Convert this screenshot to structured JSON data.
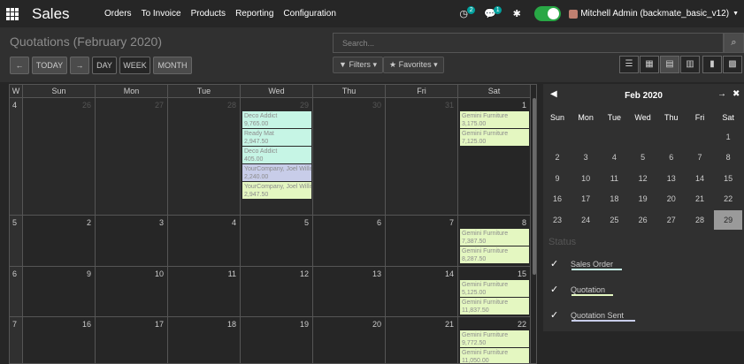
{
  "app": {
    "title": "Sales"
  },
  "menu": [
    "Orders",
    "To Invoice",
    "Products",
    "Reporting",
    "Configuration"
  ],
  "systray": {
    "activity_badge": "2",
    "messages_badge": "1",
    "user": "Mitchell Admin (backmate_basic_v12)"
  },
  "page_title": "Quotations (February 2020)",
  "search": {
    "placeholder": "Search..."
  },
  "nav": {
    "prev": "←",
    "today": "TODAY",
    "next": "→",
    "day": "DAY",
    "week": "WEEK",
    "month": "MONTH"
  },
  "filters": {
    "filters_label": "Filters",
    "favorites_label": "Favorites"
  },
  "view_icons": [
    "list-view-icon",
    "kanban-view-icon",
    "calendar-view-icon",
    "pivot-view-icon",
    "graph-view-icon",
    "grid-view-icon"
  ],
  "calendar": {
    "week_header": "W",
    "days": [
      "Sun",
      "Mon",
      "Tue",
      "Wed",
      "Thu",
      "Fri",
      "Sat"
    ],
    "weeks": [
      {
        "num": "4",
        "dates": [
          {
            "d": "26",
            "o": true
          },
          {
            "d": "27",
            "o": true
          },
          {
            "d": "28",
            "o": true
          },
          {
            "d": "29",
            "o": true
          },
          {
            "d": "30",
            "o": true
          },
          {
            "d": "31",
            "o": true
          },
          {
            "d": "1",
            "o": false
          }
        ]
      },
      {
        "num": "5",
        "dates": [
          {
            "d": "2"
          },
          {
            "d": "3"
          },
          {
            "d": "4"
          },
          {
            "d": "5"
          },
          {
            "d": "6"
          },
          {
            "d": "7"
          },
          {
            "d": "8"
          }
        ]
      },
      {
        "num": "6",
        "dates": [
          {
            "d": "9"
          },
          {
            "d": "10"
          },
          {
            "d": "11"
          },
          {
            "d": "12"
          },
          {
            "d": "13"
          },
          {
            "d": "14"
          },
          {
            "d": "15"
          }
        ]
      },
      {
        "num": "7",
        "dates": [
          {
            "d": "16"
          },
          {
            "d": "17"
          },
          {
            "d": "18"
          },
          {
            "d": "19"
          },
          {
            "d": "20"
          },
          {
            "d": "21"
          },
          {
            "d": "22"
          }
        ]
      }
    ],
    "events": [
      {
        "week": 0,
        "day": 3,
        "slot": 0,
        "name": "Deco Addict",
        "amount": "9,765.00",
        "status": "sq"
      },
      {
        "week": 0,
        "day": 3,
        "slot": 1,
        "name": "Ready Mat",
        "amount": "2,947.50",
        "status": "sq"
      },
      {
        "week": 0,
        "day": 3,
        "slot": 2,
        "name": "Deco Addict",
        "amount": "405.00",
        "status": "sq"
      },
      {
        "week": 0,
        "day": 3,
        "slot": 3,
        "name": "YourCompany, Joel Willis",
        "amount": "2,240.00",
        "status": "qs"
      },
      {
        "week": 0,
        "day": 3,
        "slot": 4,
        "name": "YourCompany, Joel Willis",
        "amount": "2,947.50",
        "status": "qt"
      },
      {
        "week": 0,
        "day": 6,
        "slot": 0,
        "name": "Gemini Furniture",
        "amount": "3,175.00",
        "status": "qt"
      },
      {
        "week": 0,
        "day": 6,
        "slot": 1,
        "name": "Gemini Furniture",
        "amount": "7,125.00",
        "status": "qt"
      },
      {
        "week": 1,
        "day": 6,
        "slot": 0,
        "name": "Gemini Furniture",
        "amount": "7,387.50",
        "status": "qt"
      },
      {
        "week": 1,
        "day": 6,
        "slot": 1,
        "name": "Gemini Furniture",
        "amount": "8,287.50",
        "status": "qt"
      },
      {
        "week": 2,
        "day": 6,
        "slot": 0,
        "name": "Gemini Furniture",
        "amount": "5,125.00",
        "status": "qt"
      },
      {
        "week": 2,
        "day": 6,
        "slot": 1,
        "name": "Gemini Furniture",
        "amount": "11,837.50",
        "status": "qt"
      },
      {
        "week": 3,
        "day": 6,
        "slot": 0,
        "name": "Gemini Furniture",
        "amount": "9,772.50",
        "status": "qt"
      },
      {
        "week": 3,
        "day": 6,
        "slot": 1,
        "name": "Gemini Furniture",
        "amount": "11,050.00",
        "status": "qt"
      }
    ]
  },
  "mini_calendar": {
    "month": "Feb 2020",
    "days": [
      "Sun",
      "Mon",
      "Tue",
      "Wed",
      "Thu",
      "Fri",
      "Sat"
    ],
    "rows": [
      [
        "",
        "",
        "",
        "",
        "",
        "",
        "1"
      ],
      [
        "2",
        "3",
        "4",
        "5",
        "6",
        "7",
        "8"
      ],
      [
        "9",
        "10",
        "11",
        "12",
        "13",
        "14",
        "15"
      ],
      [
        "16",
        "17",
        "18",
        "19",
        "20",
        "21",
        "22"
      ],
      [
        "23",
        "24",
        "25",
        "26",
        "27",
        "28",
        "29"
      ]
    ],
    "selected": "29"
  },
  "status_filter": {
    "title": "Status",
    "items": [
      {
        "label": "Sales Order",
        "color": "#c6f5e5"
      },
      {
        "label": "Quotation",
        "color": "#e4f7c1"
      },
      {
        "label": "Quotation Sent",
        "color": "#c8cde9"
      }
    ]
  }
}
